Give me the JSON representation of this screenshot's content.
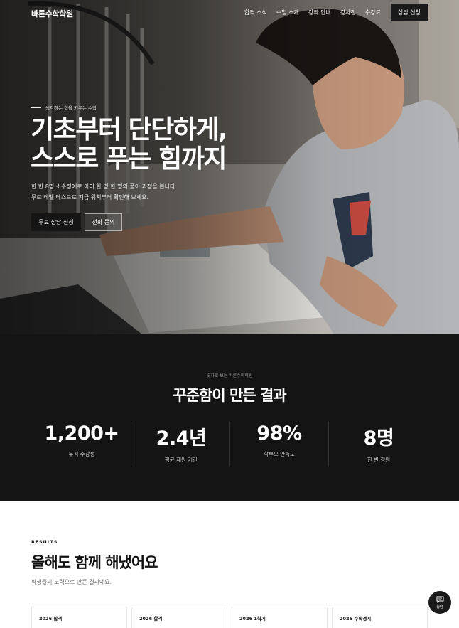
{
  "header": {
    "logo": "바른수학학원",
    "nav": [
      "합격 소식",
      "수업 소개",
      "강좌 안내",
      "강사진",
      "수강료"
    ],
    "cta": "상담 신청"
  },
  "hero": {
    "eyebrow": "생각하는 힘을 키우는 수학",
    "title_line1": "기초부터 단단하게,",
    "title_line2": "스스로 푸는 힘까지",
    "desc_line1": "한 반 8명 소수정예로 아이 한 명 한 명의 풀이 과정을 봅니다.",
    "desc_line2": "무료 레벨 테스트로 지금 위치부터 확인해 보세요.",
    "primary_button": "무료 상담 신청",
    "secondary_button": "전화 문의"
  },
  "stats": {
    "eyebrow": "숫자로 보는 바른수학학원",
    "title": "꾸준함이 만든 결과",
    "items": [
      {
        "value": "1,200+",
        "label": "누적 수강생"
      },
      {
        "value": "2.4년",
        "label": "평균 재원 기간"
      },
      {
        "value": "98%",
        "label": "학부모 만족도"
      },
      {
        "value": "8명",
        "label": "한 반 정원"
      }
    ]
  },
  "results": {
    "eyebrow": "RESULTS",
    "title": "올해도 함께 해냈어요",
    "subtitle": "학생들의 노력으로 만든 결과예요.",
    "cards": [
      "2026 합격",
      "2026 합격",
      "2026 1학기",
      "2026 수학경시"
    ]
  },
  "fab": {
    "label": "상담",
    "icon": "chat-icon"
  }
}
